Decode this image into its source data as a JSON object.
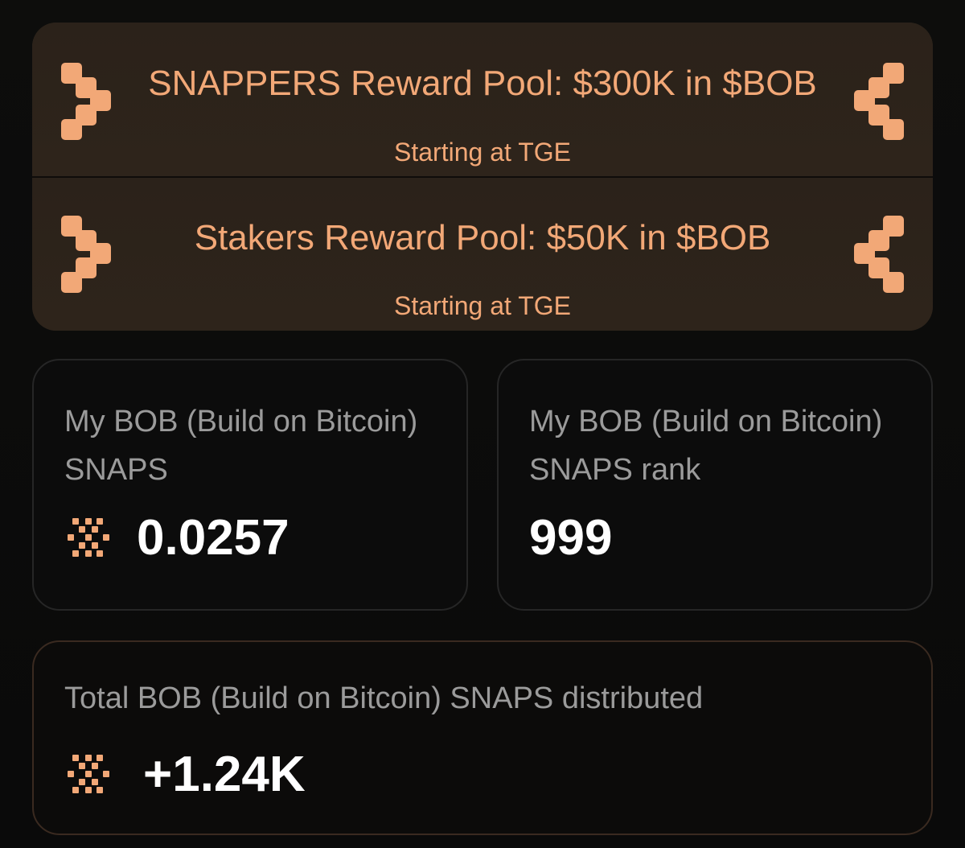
{
  "theme": {
    "accent": "#f2a877",
    "value_text": "#ffffff",
    "label_text": "#9b9b9b"
  },
  "pools": [
    {
      "title": "SNAPPERS Reward Pool: $300K in $BOB",
      "subtitle": "Starting at TGE",
      "icons": [
        "bob-logo-icon",
        "bob-logo-mirrored-icon"
      ]
    },
    {
      "title": "Stakers Reward Pool: $50K in $BOB",
      "subtitle": "Starting at TGE",
      "icons": [
        "bob-logo-icon",
        "bob-logo-mirrored-icon"
      ]
    }
  ],
  "stats": {
    "my_snaps": {
      "label": "My BOB (Build on Bitcoin) SNAPS",
      "value": "0.0257",
      "icon": "snaps-token-icon"
    },
    "my_rank": {
      "label": "My BOB (Build on Bitcoin) SNAPS rank",
      "value": "999"
    },
    "total_distributed": {
      "label": "Total BOB (Build on Bitcoin) SNAPS distributed",
      "value": "+1.24K",
      "icon": "snaps-token-icon"
    }
  }
}
